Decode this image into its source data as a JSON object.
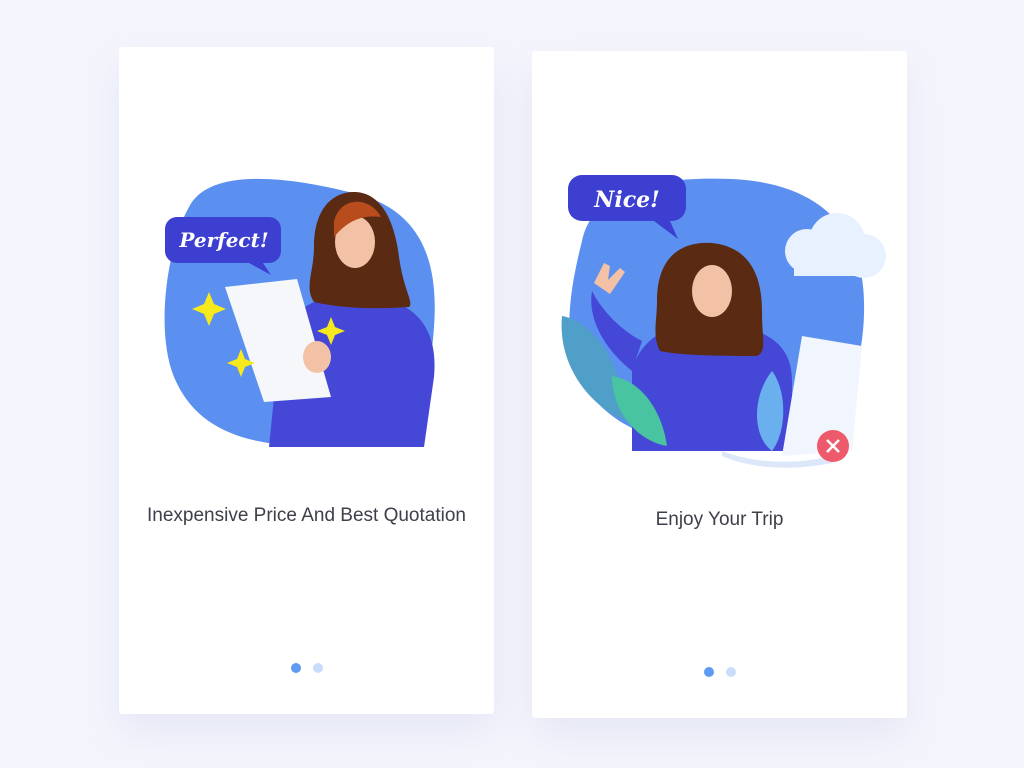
{
  "cards": [
    {
      "bubble": "Perfect!",
      "title": "Inexpensive Price And Best Quotation",
      "pagination": {
        "current": 1,
        "total": 2
      }
    },
    {
      "bubble": "Nice!",
      "title": "Enjoy Your Trip",
      "pagination": {
        "current": 1,
        "total": 2
      }
    }
  ],
  "colors": {
    "accent": "#5d9bf0",
    "dot_inactive": "#c9ddfb",
    "blob": "#5b8ff0",
    "shirt": "#4548d6",
    "bubble": "#3d3fd0",
    "close": "#ec5a6b"
  }
}
